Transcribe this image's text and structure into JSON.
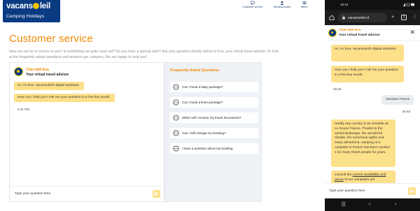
{
  "desktop": {
    "logo": {
      "name_part1": "vacans",
      "name_part2": "leil",
      "subtitle": "Camping Holidays"
    },
    "nav": [
      {
        "label": "Customer service",
        "icon": "chat-icon"
      },
      {
        "label": "MyVacansoleil",
        "icon": "user-icon"
      },
      {
        "label": "Menu",
        "icon": "hamburger-icon"
      }
    ],
    "page_title": "Customer service",
    "intro": "How can we be of service to you? Is something not quite clear yet? Do you have a special wish? Ask your question directly below to Eva, your virtual travel advisor. Or look at the frequently asked questions and answers per category. We are happy to help you!",
    "chat": {
      "name": "Chat with Eva",
      "role": "Your virtual travel advisor",
      "messages": [
        "Hi, I'm Eva, Vacansoleil's digital assistant.",
        "How can I help you? Ask me your question in a few key words."
      ],
      "time": "4:31 PM",
      "input_placeholder": "Type your question here"
    },
    "faq": {
      "title": "Frequently Asked Questions",
      "items": [
        "Can I book a baby package?",
        "Can I book a linen package?",
        "When will I receive my travel documents?",
        "Can I still change my booking?",
        "I have a question about my booking"
      ]
    }
  },
  "mobile": {
    "status_time": "16:44",
    "url": "vacansoleil.nl",
    "tools": [
      "+",
      "1",
      "⋮"
    ],
    "chat": {
      "name": "Chat with Eva",
      "role": "Your virtual travel advisor",
      "bot_msg_1": "Hi, I'm Eva, Vacansoleil's digital assistant.",
      "bot_msg_2": "How can I help you? Ask me your question in a few key words.",
      "time_1": "16:42",
      "user_msg": "Vacation France",
      "time_2": "16:43",
      "bot_msg_3": "Hardly any country is as versatile as Le Douce France. Thanks to the varied landscape, the wonderful climate, the numerous sights and many attractions, camping at a campsite in France has been number 1 for many Dutch people for years.",
      "bot_msg_4_pre": "Consult the ",
      "bot_msg_4_link": "current availability and prices",
      "bot_msg_4_post": " of our campsites per",
      "input_placeholder": "Type your question here"
    }
  },
  "colors": {
    "brand_blue": "#0a3a82",
    "brand_orange": "#f08a00",
    "bubble_yellow": "#fde08a",
    "sun_yellow": "#f5c400"
  }
}
